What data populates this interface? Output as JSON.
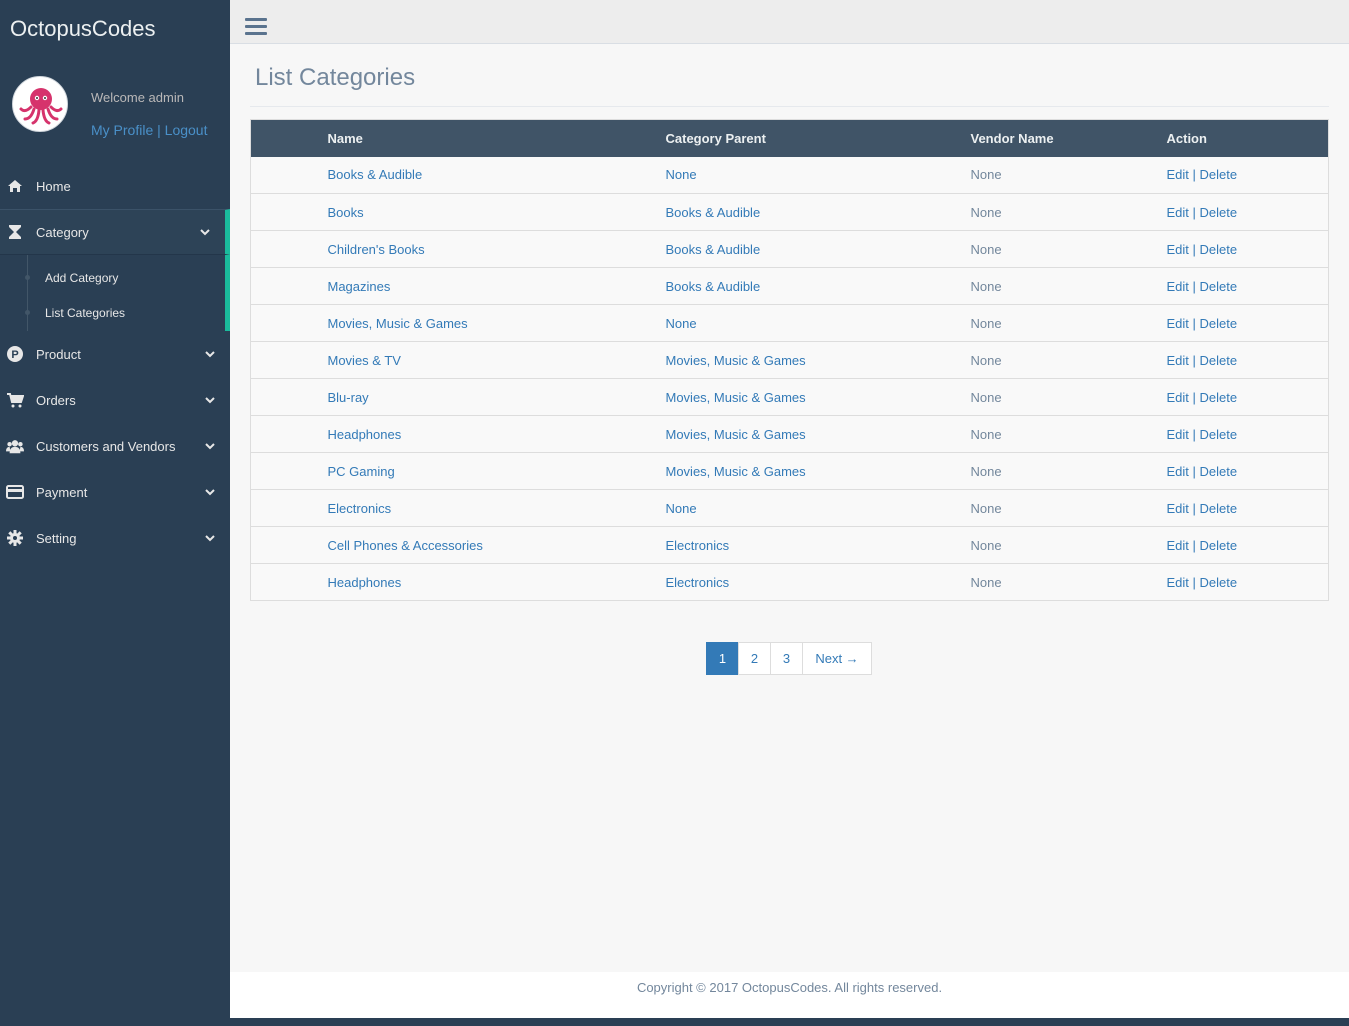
{
  "app": {
    "brand": "OctopusCodes",
    "welcome": "Welcome admin",
    "my_profile": "My Profile",
    "link_sep": " | ",
    "logout": "Logout"
  },
  "sidebar": {
    "items": [
      {
        "label": "Home",
        "icon": "home-icon"
      },
      {
        "label": "Category",
        "icon": "hourglass-icon",
        "active": true
      },
      {
        "label": "Product",
        "icon": "p-circle-icon"
      },
      {
        "label": "Orders",
        "icon": "cart-icon"
      },
      {
        "label": "Customers and Vendors",
        "icon": "users-icon"
      },
      {
        "label": "Payment",
        "icon": "credit-card-icon"
      },
      {
        "label": "Setting",
        "icon": "gear-icon"
      }
    ],
    "category_sub": [
      "Add Category",
      "List Categories"
    ]
  },
  "main": {
    "title": "List Categories",
    "columns": [
      "Name",
      "Category Parent",
      "Vendor Name",
      "Action"
    ],
    "rows": [
      {
        "name": "Books & Audible",
        "parent": "None",
        "vendor": "None"
      },
      {
        "name": "Books",
        "parent": "Books & Audible",
        "vendor": "None"
      },
      {
        "name": "Children's Books",
        "parent": "Books & Audible",
        "vendor": "None"
      },
      {
        "name": "Magazines",
        "parent": "Books & Audible",
        "vendor": "None"
      },
      {
        "name": "Movies, Music & Games",
        "parent": "None",
        "vendor": "None"
      },
      {
        "name": "Movies & TV",
        "parent": "Movies, Music & Games",
        "vendor": "None"
      },
      {
        "name": "Blu-ray",
        "parent": "Movies, Music & Games",
        "vendor": "None"
      },
      {
        "name": "Headphones",
        "parent": "Movies, Music & Games",
        "vendor": "None"
      },
      {
        "name": "PC Gaming",
        "parent": "Movies, Music & Games",
        "vendor": "None"
      },
      {
        "name": "Electronics",
        "parent": "None",
        "vendor": "None"
      },
      {
        "name": "Cell Phones & Accessories",
        "parent": "Electronics",
        "vendor": "None"
      },
      {
        "name": "Headphones",
        "parent": "Electronics",
        "vendor": "None"
      }
    ],
    "action_edit": "Edit",
    "action_sep": " | ",
    "action_delete": "Delete",
    "pagination": [
      "1",
      "2",
      "3",
      "Next →"
    ],
    "current_page": "1"
  },
  "footer": {
    "text": "Copyright © 2017 OctopusCodes. All rights reserved."
  },
  "colors": {
    "sidebar_bg": "#2a3f54",
    "accent": "#1abb9c",
    "link": "#337ab7",
    "table_header_bg": "#405467"
  }
}
